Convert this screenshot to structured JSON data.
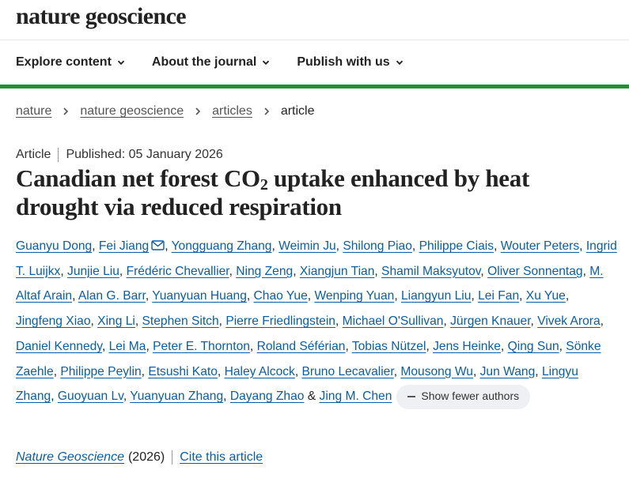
{
  "site": {
    "logo": "nature geoscience"
  },
  "nav": {
    "items": [
      "Explore content",
      "About the journal",
      "Publish with us"
    ]
  },
  "breadcrumb": {
    "items": [
      "nature",
      "nature geoscience",
      "articles"
    ],
    "current": "article"
  },
  "article": {
    "type": "Article",
    "published": "Published: 05 January 2026",
    "title_part1": "Canadian net forest CO",
    "title_sub": "2",
    "title_part2": " uptake enhanced by heat drought via reduced respiration"
  },
  "authors": {
    "list": [
      "Guanyu Dong",
      "Fei Jiang",
      "Yongguang Zhang",
      "Weimin Ju",
      "Shilong Piao",
      "Philippe Ciais",
      "Wouter Peters",
      "Ingrid T. Luijkx",
      "Junjie Liu",
      "Frédéric Chevallier",
      "Ning Zeng",
      "Xiangjun Tian",
      "Shamil Maksyutov",
      "Oliver Sonnentag",
      "M. Altaf Arain",
      "Alan G. Barr",
      "Yuanyuan Huang",
      "Chao Yue",
      "Wenping Yuan",
      "Liangyun Liu",
      "Lei Fan",
      "Xu Yue",
      "Jingfeng Xiao",
      "Xing Li",
      "Stephen Sitch",
      "Pierre Friedlingstein",
      "Michael O'Sullivan",
      "Jürgen Knauer",
      "Vivek Arora",
      "Daniel Kennedy",
      "Lei Ma",
      "Peter E. Thornton",
      "Roland Séférian",
      "Tobias Nützel",
      "Jens Heinke",
      "Qing Sun",
      "Sönke Zaehle",
      "Philippe Peylin",
      "Etsushi Kato",
      "Haley Alcock",
      "Bruno Lecavalier",
      "Mousong Wu",
      "Jun Wang",
      "Lingyu Zhang",
      "Guoyuan Lv",
      "Yuanyuan Zhang",
      "Dayang Zhao",
      "Jing M. Chen"
    ],
    "corresponding_author": "Fei Jiang",
    "separator": ", ",
    "last_separator": " & ",
    "show_fewer_label": "Show fewer authors"
  },
  "citation": {
    "journal": "Nature Geoscience",
    "year": "(2026)",
    "cite_label": "Cite this article"
  },
  "colors": {
    "accent_green": "#1f8f3a",
    "link_blue": "#0a5ea8"
  }
}
